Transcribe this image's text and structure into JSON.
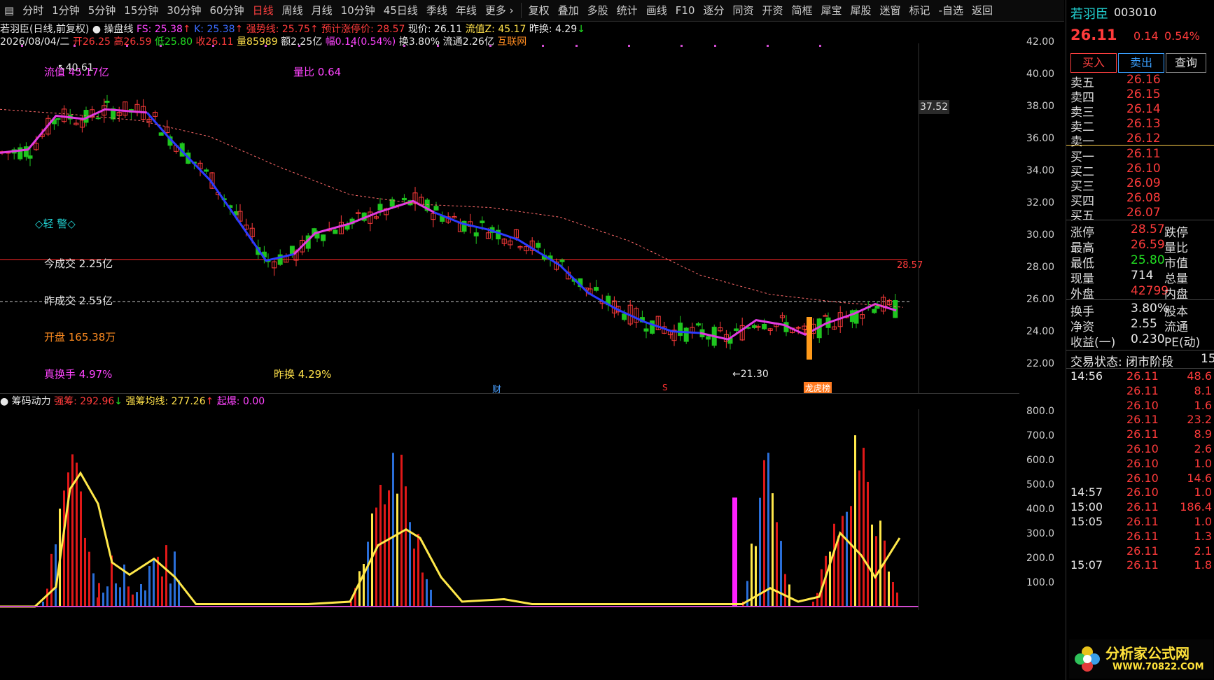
{
  "toolbar": {
    "periods": [
      "分时",
      "1分钟",
      "5分钟",
      "15分钟",
      "30分钟",
      "60分钟",
      "日线",
      "周线",
      "月线",
      "10分钟",
      "45日线",
      "季线",
      "年线",
      "更多"
    ],
    "active": "日线",
    "tools": [
      "复权",
      "叠加",
      "多股",
      "统计",
      "画线",
      "F10",
      "逐分",
      "同资",
      "开资",
      "简框",
      "犀宝",
      "犀股",
      "迷窗",
      "标记",
      "-自选",
      "返回"
    ]
  },
  "info1": {
    "title": "若羽臣(日线,前复权)",
    "indicator": "操盘线",
    "fs": "FS: 25.38",
    "ks": "K: 25.38",
    "strong": "强势线: 25.75",
    "limit_pred": "预计涨停价: 28.57",
    "now": "现价: 26.11",
    "float_val": "流值Z: 45.17",
    "prev_turnover": "昨换: 4.29"
  },
  "info2": {
    "date": "2026/08/04/二",
    "open": "开26.25",
    "high": "高26.59",
    "low": "低25.80",
    "close": "收26.11",
    "volume": "量85989",
    "amount": "额2.25亿",
    "range": "幅0.14(0.54%)",
    "turnover": "换3.80%",
    "float_cap": "流通2.26亿",
    "sector": "互联网"
  },
  "overlay": {
    "float_label": "流值",
    "float_val": "45.17亿",
    "high_mark": "40.61",
    "vol_ratio": "量比 0.64",
    "warning": "◇轻 警◇",
    "today_amount": "今成交 2.25亿",
    "prev_amount": "昨成交 2.55亿",
    "open_amount": "开盘 165.38万",
    "true_turnover": "真换手 4.97%",
    "prev_turnover": "昨换 4.29%",
    "low_mark": "←21.30",
    "limit_label": "28.57",
    "cursor_price": "37.52",
    "tag_cai": "财",
    "tag_s": "S",
    "tag_lhb": "龙虎榜"
  },
  "price_axis": [
    "42.00",
    "40.00",
    "38.00",
    "36.00",
    "34.00",
    "32.00",
    "30.00",
    "28.00",
    "26.00",
    "24.00",
    "22.00"
  ],
  "sub": {
    "title": "筹码动力",
    "strong": "强筹: 292.96",
    "avg": "强筹均线: 277.26",
    "burst": "起爆: 0.00",
    "axis": [
      "800.0",
      "700.0",
      "600.0",
      "500.0",
      "400.0",
      "300.0",
      "200.0",
      "100.0"
    ]
  },
  "right": {
    "name": "若羽臣",
    "code": "003010",
    "price": "26.11",
    "change": "0.14",
    "pct": "0.54%",
    "buy_btn": "买入",
    "sell_btn": "卖出",
    "query_btn": "查询",
    "asks": [
      {
        "label": "卖五",
        "price": "26.16"
      },
      {
        "label": "卖四",
        "price": "26.15"
      },
      {
        "label": "卖三",
        "price": "26.14"
      },
      {
        "label": "卖二",
        "price": "26.13"
      },
      {
        "label": "卖一",
        "price": "26.12"
      }
    ],
    "bids": [
      {
        "label": "买一",
        "price": "26.11"
      },
      {
        "label": "买二",
        "price": "26.10"
      },
      {
        "label": "买三",
        "price": "26.09"
      },
      {
        "label": "买四",
        "price": "26.08"
      },
      {
        "label": "买五",
        "price": "26.07"
      }
    ],
    "stats": [
      {
        "l": "涨停",
        "v": "28.57",
        "r": "跌停",
        "c": "red"
      },
      {
        "l": "最高",
        "v": "26.59",
        "r": "量比",
        "c": "red"
      },
      {
        "l": "最低",
        "v": "25.80",
        "r": "市值",
        "c": "green"
      },
      {
        "l": "现量",
        "v": "714",
        "r": "总量",
        "c": "white"
      },
      {
        "l": "外盘",
        "v": "42799",
        "r": "内盘",
        "c": "red"
      }
    ],
    "stats2": [
      {
        "l": "换手",
        "v": "3.80%",
        "r": "股本"
      },
      {
        "l": "净资",
        "v": "2.55",
        "r": "流通"
      },
      {
        "l": "收益(一)",
        "v": "0.230",
        "r": "PE(动)"
      }
    ],
    "status": "交易状态: 闭市阶段",
    "status_num": "15",
    "ticks": [
      {
        "t": "14:56",
        "p": "26.11",
        "v": "48.6"
      },
      {
        "t": "",
        "p": "26.11",
        "v": "8.1"
      },
      {
        "t": "",
        "p": "26.10",
        "v": "1.6"
      },
      {
        "t": "",
        "p": "26.11",
        "v": "23.2"
      },
      {
        "t": "",
        "p": "26.11",
        "v": "8.9"
      },
      {
        "t": "",
        "p": "26.10",
        "v": "2.6"
      },
      {
        "t": "",
        "p": "26.10",
        "v": "1.0"
      },
      {
        "t": "",
        "p": "26.10",
        "v": "14.6"
      },
      {
        "t": "14:57",
        "p": "26.10",
        "v": "1.0"
      },
      {
        "t": "15:00",
        "p": "26.11",
        "v": "186.4"
      },
      {
        "t": "15:05",
        "p": "26.11",
        "v": "1.0"
      },
      {
        "t": "",
        "p": "26.11",
        "v": "1.3"
      },
      {
        "t": "",
        "p": "26.11",
        "v": "2.1"
      },
      {
        "t": "15:07",
        "p": "26.11",
        "v": "1.8"
      }
    ],
    "logo_text": "分析家公式网",
    "logo_url": "WWW.70822.COM"
  }
}
